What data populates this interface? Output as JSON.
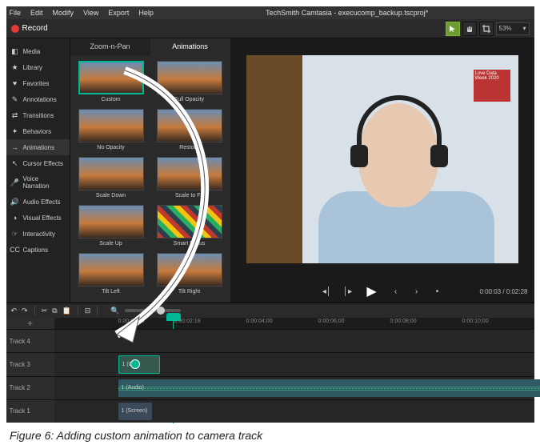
{
  "menu": {
    "items": [
      "File",
      "Edit",
      "Modify",
      "View",
      "Export",
      "Help"
    ]
  },
  "title": "TechSmith Camtasia - execucomp_backup.tscproj*",
  "toolbar": {
    "record_label": "Record",
    "zoom": "53%"
  },
  "sidebar": {
    "items": [
      {
        "icon": "◧",
        "label": "Media"
      },
      {
        "icon": "★",
        "label": "Library"
      },
      {
        "icon": "♥",
        "label": "Favorites"
      },
      {
        "icon": "✎",
        "label": "Annotations"
      },
      {
        "icon": "⇄",
        "label": "Transitions"
      },
      {
        "icon": "✦",
        "label": "Behaviors"
      },
      {
        "icon": "→",
        "label": "Animations",
        "active": true
      },
      {
        "icon": "↖",
        "label": "Cursor Effects"
      },
      {
        "icon": "🎤",
        "label": "Voice Narration"
      },
      {
        "icon": "🔊",
        "label": "Audio Effects"
      },
      {
        "icon": "◑",
        "label": "Visual Effects"
      },
      {
        "icon": "☞",
        "label": "Interactivity"
      },
      {
        "icon": "CC",
        "label": "Captions"
      }
    ]
  },
  "panel": {
    "tabs": [
      "Zoom-n-Pan",
      "Animations"
    ],
    "active_tab": 1,
    "presets": [
      [
        "Custom",
        "Full Opacity"
      ],
      [
        "No Opacity",
        "Restore"
      ],
      [
        "Scale Down",
        "Scale to Fit"
      ],
      [
        "Scale Up",
        "Smart Focus"
      ],
      [
        "Tilt Left",
        "Tilt Right"
      ]
    ]
  },
  "poster_text": "Love Data Week 2020",
  "playback": {
    "time": "0:00:03 / 0:02:28"
  },
  "timeline": {
    "ruler": [
      "0:00:00;00",
      "0:00:02:18",
      "0:00:04;00",
      "0:00:06;00",
      "0:00:08;00",
      "0:00:10;00"
    ],
    "tracks": [
      "Track 4",
      "Track 3",
      "Track 2",
      "Track 1"
    ],
    "clips": {
      "vid": "1 (C…",
      "aud": "1 (Audio)",
      "scr": "1 (Screen)"
    }
  },
  "caption": "Figure 6: Adding custom animation to camera track"
}
